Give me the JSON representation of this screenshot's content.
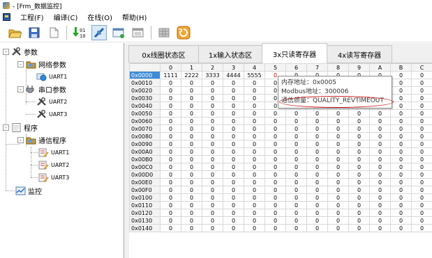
{
  "window": {
    "title": "- [Frm_数据监控]"
  },
  "menu": {
    "items": [
      "工程(F)",
      "编译(C)",
      "在线(O)",
      "帮助(H)"
    ]
  },
  "toolbar": {
    "buttons": [
      "open-folder-icon",
      "save-icon",
      "new-file-icon",
      "download-icon",
      "connect-icon",
      "monitor-window-icon",
      "window-icon",
      "grid-icon",
      "refresh-icon"
    ],
    "active": "connect-icon"
  },
  "tree": {
    "params": "参数",
    "network_params": "网络参数",
    "net_uart1": "UART1",
    "serial_params": "串口参数",
    "ser_uart2": "UART2",
    "ser_uart3": "UART3",
    "program": "程序",
    "comm_program": "通信程序",
    "prog_uart1": "UART1",
    "prog_uart2": "UART2",
    "prog_uart3": "UART3",
    "monitor": "监控"
  },
  "tabs": [
    "0x线圈状态区",
    "1x输入状态区",
    "3x只读寄存器",
    "4x读写寄存器"
  ],
  "selected_tab": 2,
  "grid": {
    "columns": [
      "",
      "0",
      "1",
      "2",
      "3",
      "4",
      "5",
      "6",
      "7",
      "8",
      "9",
      "A",
      "B",
      "C"
    ],
    "row_headers": [
      "0x0000",
      "0x0010",
      "0x0020",
      "0x0030",
      "0x0040",
      "0x0050",
      "0x0060",
      "0x0070",
      "0x0080",
      "0x0090",
      "0x00A0",
      "0x00B0",
      "0x00C0",
      "0x00D0",
      "0x00E0",
      "0x00F0",
      "0x0100",
      "0x0110",
      "0x0120",
      "0x0130",
      "0x0140"
    ],
    "first_row": [
      "1111",
      "2222",
      "3333",
      "4444",
      "5555",
      "0",
      "0",
      "0",
      "0",
      "0",
      "0",
      "0",
      "0"
    ],
    "fill": "0",
    "selected_row": 0,
    "highlighted_cell": {
      "row": 0,
      "col": 5
    }
  },
  "tooltip": {
    "line1": "内存地址：0x0005",
    "line2": "Modbus地址：300006",
    "line3": "通信质量：QUALITY_REVTIMEOUT"
  },
  "colors": {
    "selection": "#3c8bd6",
    "highlight": "#d40000",
    "annotation": "#d22020"
  }
}
